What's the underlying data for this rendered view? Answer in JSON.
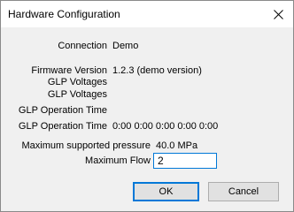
{
  "dialog": {
    "title": "Hardware Configuration"
  },
  "fields": {
    "connection_label": "Connection",
    "connection_value": "Demo",
    "firmware_label": "Firmware Version",
    "firmware_value": "1.2.3 (demo version)",
    "glp_voltages_1_label": "GLP Voltages",
    "glp_voltages_2_label": "GLP Voltages",
    "glp_op_time_1_label": "GLP Operation Time",
    "glp_op_time_2_label": "GLP Operation Time",
    "glp_op_time_2_value": "0:00 0:00 0:00 0:00 0:00",
    "max_pressure_label": "Maximum supported pressure",
    "max_pressure_value": "40.0 MPa",
    "max_flow_label": "Maximum Flow",
    "max_flow_value": "2"
  },
  "buttons": {
    "ok_label": "OK",
    "cancel_label": "Cancel"
  },
  "icons": {
    "close": "close-icon"
  }
}
